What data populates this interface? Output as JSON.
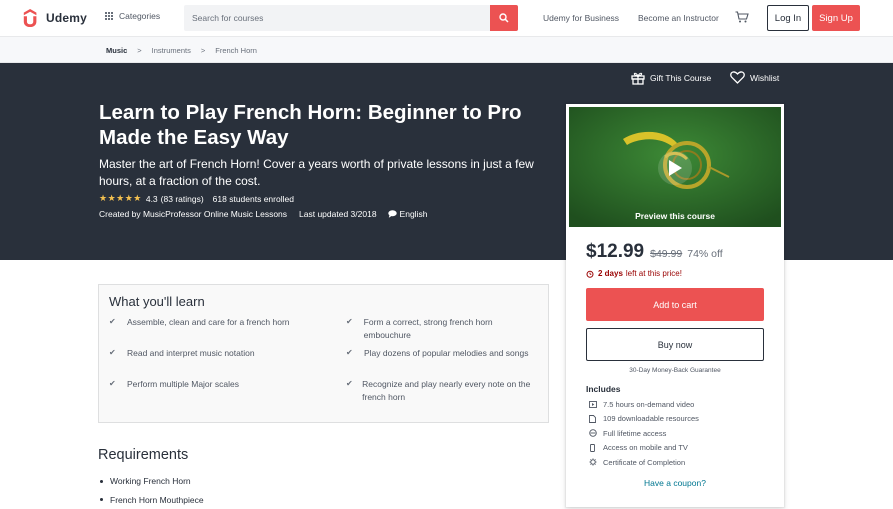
{
  "header": {
    "logo_text": "Udemy",
    "categories_label": "Categories",
    "search_placeholder": "Search for courses",
    "business_link": "Udemy for Business",
    "instructor_link": "Become an Instructor",
    "login_label": "Log In",
    "signup_label": "Sign Up",
    "accent_color": "#ec5252"
  },
  "breadcrumb": [
    "Music",
    "Instruments",
    "French Horn"
  ],
  "hero": {
    "gift_label": "Gift This Course",
    "wishlist_label": "Wishlist",
    "title": "Learn to Play French Horn: Beginner to Pro Made the Easy Way",
    "subtitle": "Master the art of French Horn! Cover a years worth of private lessons in just a few hours, at a fraction of the cost.",
    "rating_value": "4.3",
    "ratings_count": "(83 ratings)",
    "students": "618 students enrolled",
    "created_by": "Created by MusicProfessor Online Music Lessons",
    "last_updated": "Last updated 3/2018",
    "language": "English",
    "stars": "★★★★★"
  },
  "sidebar": {
    "preview_label": "Preview this course",
    "price": "$12.99",
    "old_price": "$49.99",
    "discount": "74% off",
    "timer_bold": "2 days",
    "timer_text": "left at this price!",
    "add_to_cart": "Add to cart",
    "buy_now": "Buy now",
    "guarantee": "30-Day Money-Back Guarantee",
    "includes_title": "Includes",
    "includes": [
      {
        "icon": "video-icon",
        "text": "7.5 hours on-demand video"
      },
      {
        "icon": "file-icon",
        "text": "109 downloadable resources"
      },
      {
        "icon": "infinity-icon",
        "text": "Full lifetime access"
      },
      {
        "icon": "mobile-icon",
        "text": "Access on mobile and TV"
      },
      {
        "icon": "certificate-icon",
        "text": "Certificate of Completion"
      }
    ],
    "coupon": "Have a coupon?"
  },
  "learn": {
    "title": "What you'll learn",
    "items": [
      "Assemble, clean and care for a french horn",
      "Form a correct, strong french horn embouchure",
      "Read and interpret music notation",
      "Play dozens of popular melodies and songs",
      "Perform multiple Major scales",
      "Recognize and play nearly every note on the french horn"
    ]
  },
  "requirements": {
    "title": "Requirements",
    "items": [
      "Working French Horn",
      "French Horn Mouthpiece"
    ]
  }
}
